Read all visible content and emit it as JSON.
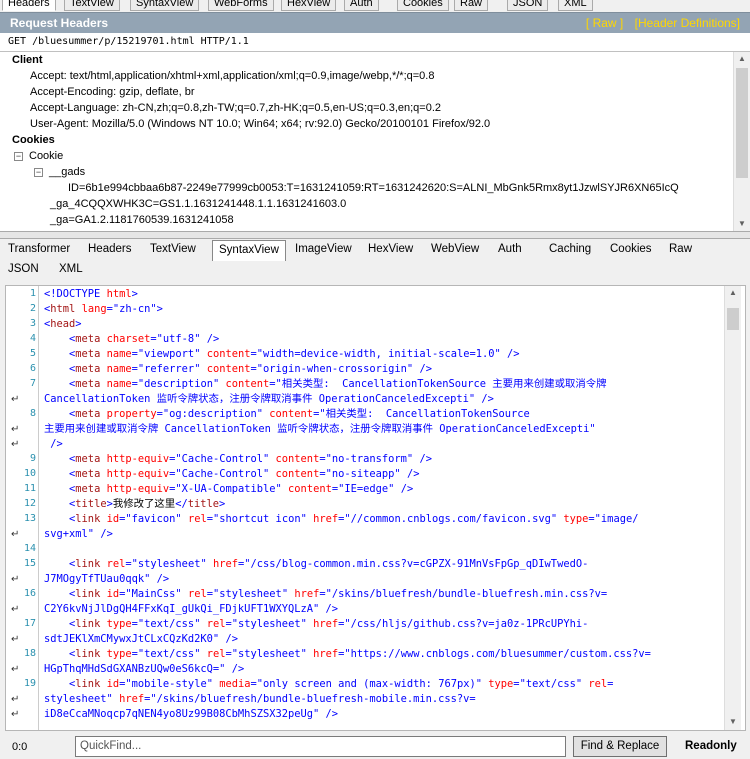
{
  "top_tabs": [
    "Headers",
    "TextView",
    "SyntaxView",
    "WebForms",
    "HexView",
    "Auth",
    "Cookies",
    "Raw",
    "JSON",
    "XML"
  ],
  "request_headers": {
    "title": "Request Headers",
    "raw_link": "[ Raw ]",
    "defs_link": "[Header Definitions]",
    "request_line": "GET /bluesummer/p/15219701.html HTTP/1.1",
    "client_label": "Client",
    "client": [
      "Accept: text/html,application/xhtml+xml,application/xml;q=0.9,image/webp,*/*;q=0.8",
      "Accept-Encoding: gzip, deflate, br",
      "Accept-Language: zh-CN,zh;q=0.8,zh-TW;q=0.7,zh-HK;q=0.5,en-US;q=0.3,en;q=0.2",
      "User-Agent: Mozilla/5.0 (Windows NT 10.0; Win64; x64; rv:92.0) Gecko/20100101 Firefox/92.0"
    ],
    "cookies_label": "Cookies",
    "cookie_node": "Cookie",
    "gads_node": "__gads",
    "gads_value": "ID=6b1e994cbbaa6b87-2249e77999cb0053:T=1631241059:RT=1631242620:S=ALNI_MbGnk5Rmx8yt1JzwlSYJR6XN65IcQ",
    "ga_4cqqx": "_ga_4CQQXWHK3C=GS1.1.1631241448.1.1.1631241603.0",
    "ga": "_ga=GA1.2.1181760539.1631241058"
  },
  "response_tabs": [
    "Transformer",
    "Headers",
    "TextView",
    "SyntaxView",
    "ImageView",
    "HexView",
    "WebView",
    "Auth",
    "Caching",
    "Cookies",
    "Raw",
    "JSON",
    "XML"
  ],
  "active_response_tab": "SyntaxView",
  "code_lines": [
    {
      "n": "1",
      "html": "<span class='bl'>&lt;!DOCTYPE</span> <span class='at'>html</span><span class='bl'>&gt;</span>"
    },
    {
      "n": "2",
      "html": "<span class='bl'>&lt;</span><span class='tg'>html</span> <span class='at'>lang</span><span class='bl'>=</span><span class='st'>\"zh-cn\"</span><span class='bl'>&gt;</span>"
    },
    {
      "n": "3",
      "html": "<span class='bl'>&lt;</span><span class='tg'>head</span><span class='bl'>&gt;</span>"
    },
    {
      "n": "4",
      "html": "    <span class='bl'>&lt;</span><span class='tg'>meta</span> <span class='at'>charset</span><span class='bl'>=</span><span class='st'>\"utf-8\"</span> <span class='bl'>/&gt;</span>"
    },
    {
      "n": "5",
      "html": "    <span class='bl'>&lt;</span><span class='tg'>meta</span> <span class='at'>name</span><span class='bl'>=</span><span class='st'>\"viewport\"</span> <span class='at'>content</span><span class='bl'>=</span><span class='st'>\"width=device-width, initial-scale=1.0\"</span> <span class='bl'>/&gt;</span>"
    },
    {
      "n": "6",
      "html": "    <span class='bl'>&lt;</span><span class='tg'>meta</span> <span class='at'>name</span><span class='bl'>=</span><span class='st'>\"referrer\"</span> <span class='at'>content</span><span class='bl'>=</span><span class='st'>\"origin-when-crossorigin\"</span> <span class='bl'>/&gt;</span>"
    },
    {
      "n": "7",
      "html": "    <span class='bl'>&lt;</span><span class='tg'>meta</span> <span class='at'>name</span><span class='bl'>=</span><span class='st'>\"description\"</span> <span class='at'>content</span><span class='bl'>=</span><span class='st'>\"相关类型:  CancellationTokenSource 主要用来创建或取消令牌</span>"
    },
    {
      "n": "w",
      "html": "<span class='st'>CancellationToken 监听令牌状态，注册令牌取消事件 OperationCanceledExcepti\"</span> <span class='bl'>/&gt;</span>"
    },
    {
      "n": "8",
      "html": "    <span class='bl'>&lt;</span><span class='tg'>meta</span> <span class='at'>property</span><span class='bl'>=</span><span class='st'>\"og:description\"</span> <span class='at'>content</span><span class='bl'>=</span><span class='st'>\"相关类型:  CancellationTokenSource</span>"
    },
    {
      "n": "w",
      "html": "<span class='st'>主要用来创建或取消令牌 CancellationToken 监听令牌状态，注册令牌取消事件 OperationCanceledExcepti\"</span>"
    },
    {
      "n": "w",
      "html": " <span class='bl'>/&gt;</span>"
    },
    {
      "n": "9",
      "html": "    <span class='bl'>&lt;</span><span class='tg'>meta</span> <span class='at'>http-equiv</span><span class='bl'>=</span><span class='st'>\"Cache-Control\"</span> <span class='at'>content</span><span class='bl'>=</span><span class='st'>\"no-transform\"</span> <span class='bl'>/&gt;</span>"
    },
    {
      "n": "10",
      "html": "    <span class='bl'>&lt;</span><span class='tg'>meta</span> <span class='at'>http-equiv</span><span class='bl'>=</span><span class='st'>\"Cache-Control\"</span> <span class='at'>content</span><span class='bl'>=</span><span class='st'>\"no-siteapp\"</span> <span class='bl'>/&gt;</span>"
    },
    {
      "n": "11",
      "html": "    <span class='bl'>&lt;</span><span class='tg'>meta</span> <span class='at'>http-equiv</span><span class='bl'>=</span><span class='st'>\"X-UA-Compatible\"</span> <span class='at'>content</span><span class='bl'>=</span><span class='st'>\"IE=edge\"</span> <span class='bl'>/&gt;</span>"
    },
    {
      "n": "12",
      "html": "    <span class='bl'>&lt;</span><span class='tg'>title</span><span class='bl'>&gt;</span><span class='tx'>我修改了这里</span><span class='bl'>&lt;/</span><span class='tg'>title</span><span class='bl'>&gt;</span>"
    },
    {
      "n": "13",
      "html": "    <span class='bl'>&lt;</span><span class='tg'>link</span> <span class='at'>id</span><span class='bl'>=</span><span class='st'>\"favicon\"</span> <span class='at'>rel</span><span class='bl'>=</span><span class='st'>\"shortcut icon\"</span> <span class='at'>href</span><span class='bl'>=</span><span class='st'>\"//common.cnblogs.com/favicon.svg\"</span> <span class='at'>type</span><span class='bl'>=</span><span class='st'>\"image/</span>"
    },
    {
      "n": "w",
      "html": "<span class='st'>svg+xml\"</span> <span class='bl'>/&gt;</span>"
    },
    {
      "n": "14",
      "html": ""
    },
    {
      "n": "15",
      "html": "    <span class='bl'>&lt;</span><span class='tg'>link</span> <span class='at'>rel</span><span class='bl'>=</span><span class='st'>\"stylesheet\"</span> <span class='at'>href</span><span class='bl'>=</span><span class='st'>\"/css/blog-common.min.css?v=cGPZX-91MnVsFpGp_qDIwTwedO-</span>"
    },
    {
      "n": "w",
      "html": "<span class='st'>J7MOgyTfTUau0qqk\"</span> <span class='bl'>/&gt;</span>"
    },
    {
      "n": "16",
      "html": "    <span class='bl'>&lt;</span><span class='tg'>link</span> <span class='at'>id</span><span class='bl'>=</span><span class='st'>\"MainCss\"</span> <span class='at'>rel</span><span class='bl'>=</span><span class='st'>\"stylesheet\"</span> <span class='at'>href</span><span class='bl'>=</span><span class='st'>\"/skins/bluefresh/bundle-bluefresh.min.css?v=</span>"
    },
    {
      "n": "w",
      "html": "<span class='st'>C2Y6kvNjJlDgQH4FFxKqI_gUkQi_FDjkUFT1WXYQLzA\"</span> <span class='bl'>/&gt;</span>"
    },
    {
      "n": "17",
      "html": "    <span class='bl'>&lt;</span><span class='tg'>link</span> <span class='at'>type</span><span class='bl'>=</span><span class='st'>\"text/css\"</span> <span class='at'>rel</span><span class='bl'>=</span><span class='st'>\"stylesheet\"</span> <span class='at'>href</span><span class='bl'>=</span><span class='st'>\"/css/hljs/github.css?v=ja0z-1PRcUPYhi-</span>"
    },
    {
      "n": "w",
      "html": "<span class='st'>sdtJEKlXmCMywxJtCLxCQzKd2K0\"</span> <span class='bl'>/&gt;</span>"
    },
    {
      "n": "18",
      "html": "    <span class='bl'>&lt;</span><span class='tg'>link</span> <span class='at'>type</span><span class='bl'>=</span><span class='st'>\"text/css\"</span> <span class='at'>rel</span><span class='bl'>=</span><span class='st'>\"stylesheet\"</span> <span class='at'>href</span><span class='bl'>=</span><span class='st'>\"https://www.cnblogs.com/bluesummer/custom.css?v=</span>"
    },
    {
      "n": "w",
      "html": "<span class='st'>HGpThqMHdSdGXANBzUQw0eS6kcQ=\"</span> <span class='bl'>/&gt;</span>"
    },
    {
      "n": "19",
      "html": "    <span class='bl'>&lt;</span><span class='tg'>link</span> <span class='at'>id</span><span class='bl'>=</span><span class='st'>\"mobile-style\"</span> <span class='at'>media</span><span class='bl'>=</span><span class='st'>\"only screen and (max-width: 767px)\"</span> <span class='at'>type</span><span class='bl'>=</span><span class='st'>\"text/css\"</span> <span class='at'>rel</span><span class='bl'>=</span>"
    },
    {
      "n": "w",
      "html": "<span class='st'>stylesheet\"</span> <span class='at'>href</span><span class='bl'>=</span><span class='st'>\"/skins/bluefresh/bundle-bluefresh-mobile.min.css?v=</span>"
    },
    {
      "n": "w",
      "html": "<span class='st'>iD8eCcaMNoqcp7qNEN4yo8Uz99B08CbMhSZSX32peUg\"</span> <span class='bl'>/&gt;</span>"
    }
  ],
  "status": {
    "position": "0:0",
    "quickfind_placeholder": "QuickFind...",
    "find_replace": "Find & Replace",
    "readonly": "Readonly"
  }
}
